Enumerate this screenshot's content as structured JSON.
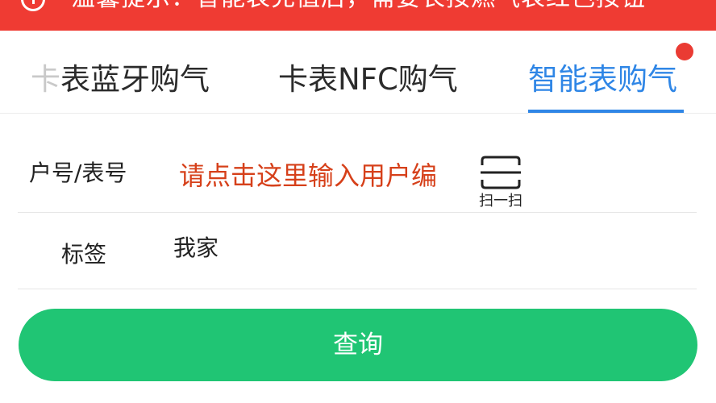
{
  "banner": {
    "text": "温馨提示：智能表充值后，需要长按燃气表红色按钮"
  },
  "tabs": [
    {
      "label_faded": "卡",
      "label": "表蓝牙购气",
      "active": false
    },
    {
      "label": "卡表NFC购气",
      "active": false
    },
    {
      "label": "智能表购气",
      "active": true
    }
  ],
  "form": {
    "account": {
      "label": "户号/表号",
      "placeholder": "请点击这里输入用户编",
      "scan_label": "扫一扫"
    },
    "tag": {
      "label": "标签",
      "value": "我家"
    }
  },
  "query_button": "查询",
  "colors": {
    "banner": "#ef3b33",
    "active_tab": "#2f86e6",
    "placeholder": "#d6401a",
    "button": "#20c574",
    "badge": "#ea3b33"
  }
}
